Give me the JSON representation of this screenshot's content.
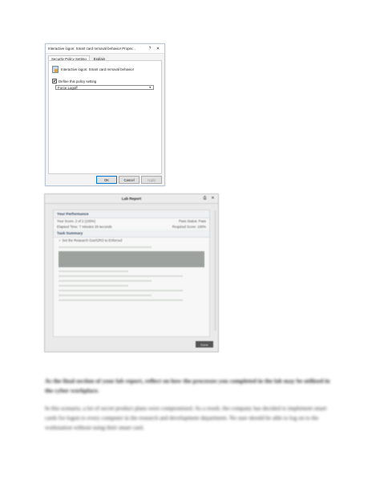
{
  "dialog": {
    "title": "Interactive logon: Smart card removal behavior Proper...",
    "help_glyph": "?",
    "close_glyph": "✕",
    "tabs": [
      "Security Policy Setting",
      "Explain"
    ],
    "policy_name": "Interactive logon: Smart card removal behavior",
    "define_checkbox_label": "Define this policy setting",
    "define_checked": true,
    "select_value": "Force Logoff",
    "buttons": {
      "ok": "OK",
      "cancel": "Cancel",
      "apply": "Apply"
    }
  },
  "lab_report": {
    "title": "Lab Report",
    "section_title": "Your Performance",
    "your_score": "Your Score: 2 of 2 (100%)",
    "pass_status": "Pass Status: Pass",
    "elapsed_time": "Elapsed Time: 7 minutes 29 seconds",
    "required_score": "Required Score: 100%",
    "task_summary_title": "Task Summary",
    "task_1": "✓ Set the Research Gov/GRO to Enforced",
    "done_button": "Done"
  },
  "body_text": {
    "heading": "As the final section of your lab report, reflect on how the processes you completed in the lab may be utilized in the cyber workplace.",
    "paragraph_1": "In this scenario, a lot of secret product plans were compromised. As a result, the company has decided to implement smart cards for logon to every computer in the research and development department. No user should be able to log on to the workstation without using their smart card."
  }
}
